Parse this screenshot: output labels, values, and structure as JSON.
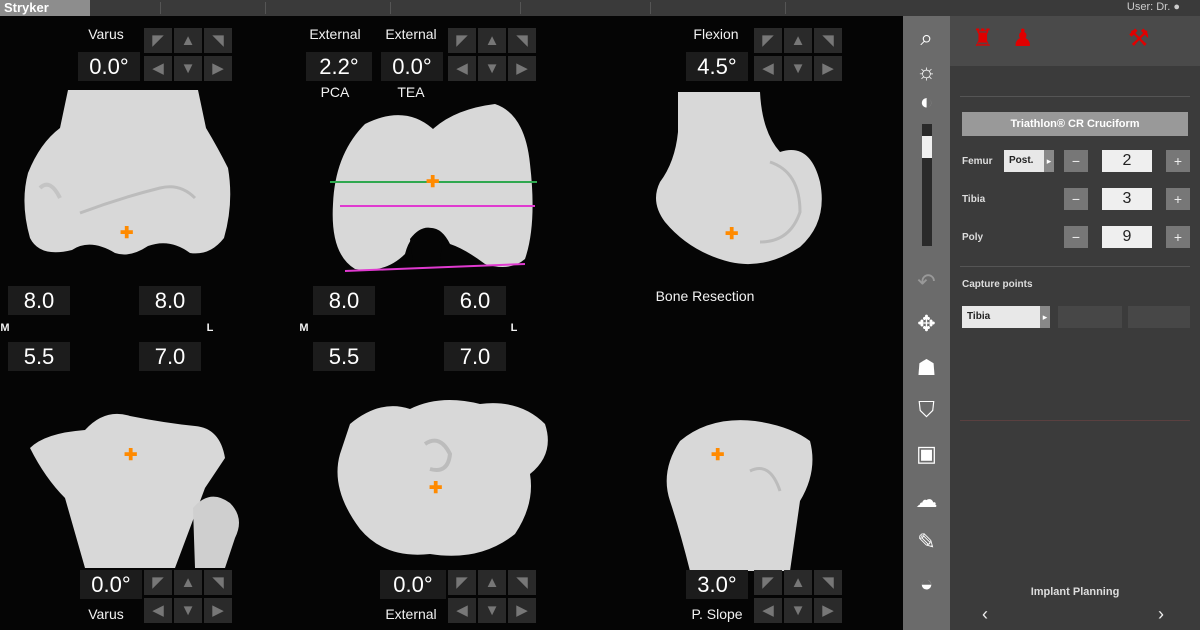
{
  "topbar": {
    "brand": "Stryker",
    "user": "User: Dr. ●"
  },
  "femur_views": {
    "anterior": {
      "top_label": "Varus",
      "angle": "0.0°",
      "gap_lateral_m": "8.0",
      "gap_lateral_l": "8.0"
    },
    "distal": {
      "top_label_left": "External",
      "top_label_right": "External",
      "angle_left": "2.2°",
      "angle_right": "0.0°",
      "sub_label_left": "PCA",
      "sub_label_right": "TEA",
      "gap_m": "8.0",
      "gap_l": "6.0"
    },
    "lateral": {
      "top_label": "Flexion",
      "angle": "4.5°"
    }
  },
  "gap_labels": {
    "m": "M",
    "l": "L"
  },
  "tibia_gaps": {
    "left_m": "5.5",
    "left_l": "7.0",
    "mid_m": "5.5",
    "mid_l": "7.0"
  },
  "bone_resection_label": "Bone Resection",
  "tibia_views": {
    "anterior": {
      "angle": "0.0°",
      "bottom_label": "Varus"
    },
    "axial": {
      "angle": "0.0°",
      "bottom_label": "External"
    },
    "lateral": {
      "angle": "3.0°",
      "bottom_label": "P. Slope"
    }
  },
  "panel": {
    "implant_name": "Triathlon® CR Cruciform",
    "rows": [
      {
        "label": "Femur",
        "option": "Post.",
        "value": "2"
      },
      {
        "label": "Tibia",
        "value": "3"
      },
      {
        "label": "Poly",
        "value": "9"
      }
    ],
    "capture_points_label": "Capture points",
    "capture_option": "Tibia",
    "footer_title": "Implant Planning",
    "prev": "‹",
    "next": "›"
  },
  "colors": {
    "accent_red": "#e00000",
    "marker_orange": "#ff8a00",
    "line_green": "#2fa84f",
    "line_magenta": "#e03ad0"
  },
  "icons": [
    "search-icon",
    "brightness-icon",
    "contrast-icon",
    "undo-icon",
    "move-icon",
    "femur-icon",
    "knee-icon",
    "tibia-view-icon",
    "implant-icon",
    "probe-icon",
    "mask-icon"
  ]
}
